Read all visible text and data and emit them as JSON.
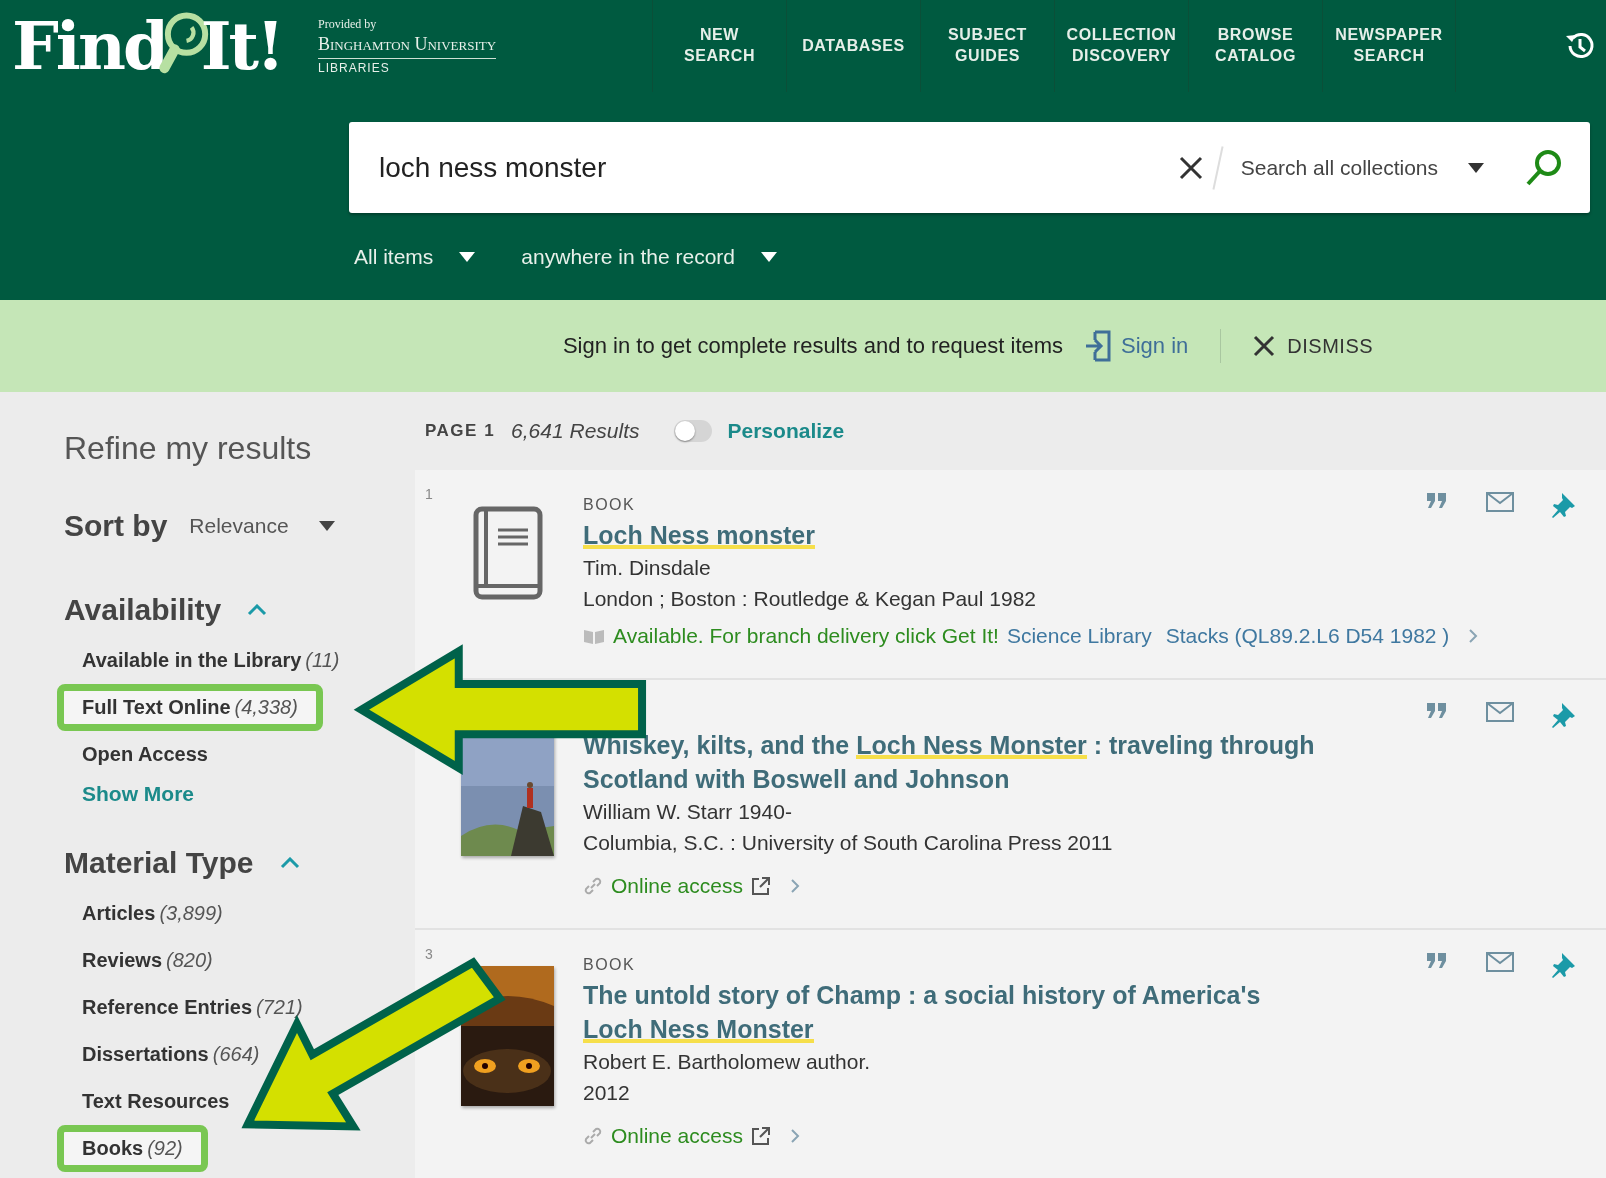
{
  "logo": {
    "parts": [
      "Find",
      "It!"
    ],
    "provided_by": "Provided by",
    "university": "Binghamton University",
    "libraries": "LIBRARIES"
  },
  "nav": [
    "NEW SEARCH",
    "DATABASES",
    "SUBJECT GUIDES",
    "COLLECTION DISCOVERY",
    "BROWSE CATALOG",
    "NEWSPAPER SEARCH"
  ],
  "search": {
    "value": "loch ness monster",
    "scope": "Search all collections",
    "filters": [
      "All items",
      "anywhere in the record"
    ]
  },
  "banner": {
    "message": "Sign in to get complete results and to request items",
    "sign_in": "Sign in",
    "dismiss": "DISMISS"
  },
  "sidebar": {
    "title": "Refine my results",
    "sort_label": "Sort by",
    "sort_value": "Relevance",
    "facets": [
      {
        "title": "Availability",
        "expanded": true,
        "items": [
          {
            "label": "Available in the Library",
            "count": "(11)",
            "highlighted": false
          },
          {
            "label": "Full Text Online",
            "count": "(4,338)",
            "highlighted": true
          },
          {
            "label": "Open Access",
            "highlighted": false
          }
        ],
        "more": "Show More"
      },
      {
        "title": "Material Type",
        "expanded": true,
        "items": [
          {
            "label": "Articles",
            "count": "(3,899)",
            "highlighted": false
          },
          {
            "label": "Reviews",
            "count": "(820)",
            "highlighted": false
          },
          {
            "label": "Reference Entries",
            "count": "(721)",
            "highlighted": false
          },
          {
            "label": "Dissertations",
            "count": "(664)",
            "highlighted": false
          },
          {
            "label": "Text Resources",
            "highlighted": false
          },
          {
            "label": "Books",
            "count": "(92)",
            "highlighted": true
          }
        ]
      }
    ]
  },
  "results_header": {
    "page": "PAGE 1",
    "count": "6,641 Results",
    "personalize": "Personalize",
    "personalize_on": false
  },
  "results": [
    {
      "number": "1",
      "type": "BOOK",
      "cover": {
        "kind": "icon"
      },
      "title": [
        {
          "text": "Loch Ness monster",
          "highlight": true
        }
      ],
      "lines": [
        "Tim. Dinsdale",
        "London ; Boston : Routledge & Kegan Paul 1982"
      ],
      "availability": {
        "kind": "physical",
        "status": "Available. For branch delivery click Get It!",
        "library": "Science Library",
        "location": "Stacks (QL89.2.L6 D54 1982 )"
      }
    },
    {
      "cover": {
        "kind": "picture"
      },
      "title": [
        {
          "text": "Whiskey, kilts, and the ",
          "highlight": false
        },
        {
          "text": "Loch Ness Monster",
          "highlight": true
        },
        {
          "text": " : traveling through Scotland with Boswell and Johnson",
          "highlight": false
        }
      ],
      "lines": [
        "William W. Starr 1940-",
        "Columbia, S.C. : University of South Carolina Press 2011"
      ],
      "availability": {
        "kind": "online",
        "status": "Online access"
      }
    },
    {
      "number": "3",
      "type": "BOOK",
      "cover": {
        "kind": "picture"
      },
      "title": [
        {
          "text": "The untold story of Champ : a social history of America's ",
          "highlight": false
        },
        {
          "text": "Loch Ness Monster",
          "highlight": true
        }
      ],
      "lines": [
        "Robert E. Bartholomew author.",
        "2012"
      ],
      "availability": {
        "kind": "online",
        "status": "Online access"
      }
    }
  ]
}
